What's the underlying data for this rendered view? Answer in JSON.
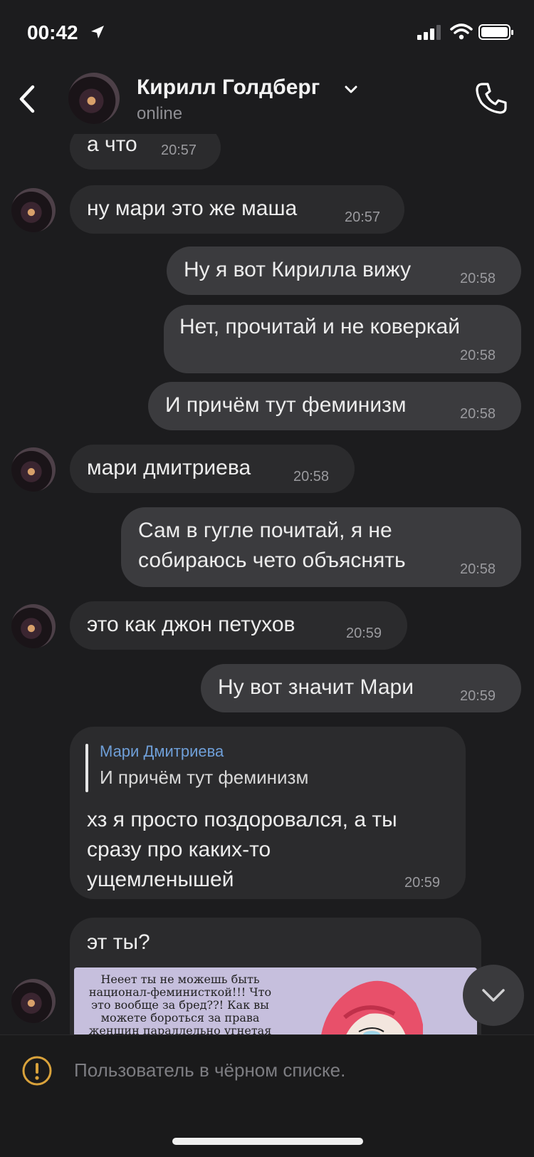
{
  "status_bar": {
    "time": "00:42"
  },
  "header": {
    "contact_name": "Кирилл Голдберг",
    "contact_status": "online"
  },
  "messages": [
    {
      "dir": "in",
      "text": "а что",
      "time": "20:57"
    },
    {
      "dir": "in",
      "text": "ну мари это же маша",
      "time": "20:57"
    },
    {
      "dir": "out",
      "text": "Ну я вот Кирилла вижу",
      "time": "20:58"
    },
    {
      "dir": "out",
      "text": "Нет, прочитай и не коверкай",
      "time": "20:58"
    },
    {
      "dir": "out",
      "text": "И причём тут феминизм",
      "time": "20:58"
    },
    {
      "dir": "in",
      "text": "мари дмитриева",
      "time": "20:58"
    },
    {
      "dir": "out",
      "lines": [
        "Сам в гугле почитай, я не",
        "собираюсь чето объяснять"
      ],
      "time": "20:58"
    },
    {
      "dir": "in",
      "text": "это как джон петухов",
      "time": "20:59"
    },
    {
      "dir": "out",
      "text": "Ну вот значит Мари",
      "time": "20:59"
    },
    {
      "dir": "in",
      "reply_to": {
        "author": "Мари Дмитриева",
        "text": "И причём тут феминизм"
      },
      "lines": [
        "хз я просто поздоровался, а ты",
        "сразу про каких-то",
        "ущемленышей"
      ],
      "time": "20:59"
    },
    {
      "dir": "in",
      "text": "эт ты?",
      "image_caption": [
        "Нееет ты не можешь быть",
        "национал-феминисткой!!! Что",
        "это вообще за бред??! Как вы",
        "можете бороться за права",
        "женщин параллельно угнетая"
      ]
    }
  ],
  "footer": {
    "blocked_notice": "Пользователь в чёрном списке."
  },
  "colors": {
    "bubble_in": "#2b2b2d",
    "bubble_out": "#3b3b3e",
    "quote_author": "#6f9fd8",
    "warning": "#d9a23b"
  }
}
